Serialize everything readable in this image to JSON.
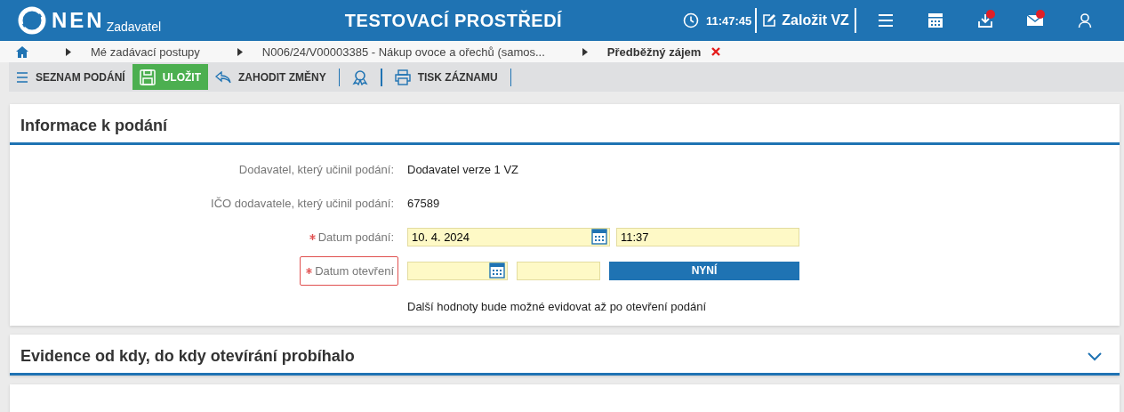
{
  "header": {
    "logo": "NEN",
    "logo_sub": "Zadavatel",
    "title": "TESTOVACÍ PROSTŘEDÍ",
    "clock": "11:47:45",
    "create_button": "Založit VZ",
    "icons": [
      {
        "kind": "menu",
        "badge": false
      },
      {
        "kind": "calendar",
        "badge": false
      },
      {
        "kind": "inbox",
        "badge": true
      },
      {
        "kind": "mail",
        "badge": true
      },
      {
        "kind": "user",
        "badge": false
      }
    ]
  },
  "breadcrumb": [
    {
      "label": "Mé zadávací postupy",
      "current": false
    },
    {
      "label": "N006/24/V00003385 - Nákup ovoce a ořechů (samos...",
      "current": false
    },
    {
      "label": "Předběžný zájem",
      "current": true
    }
  ],
  "toolbar": [
    {
      "kind": "list",
      "label": "SEZNAM PODÁNÍ"
    },
    {
      "kind": "save",
      "label": "ULOŽIT"
    },
    {
      "kind": "discard",
      "label": "ZAHODIT ZMĚNY"
    },
    {
      "kind": "award"
    },
    {
      "kind": "print",
      "label": "TISK ZÁZNAMU"
    }
  ],
  "section": {
    "title": "Informace k podání",
    "rows": [
      {
        "kind": "text",
        "label": "Dodavatel, který učinil podání:",
        "value": "Dodavatel verze 1 VZ"
      },
      {
        "kind": "text",
        "label": "IČO dodavatele, který učinil podání:",
        "value": "67589"
      },
      {
        "kind": "datetime",
        "label": "Datum podání:",
        "required": true,
        "invalid": false,
        "date": "10. 4. 2024",
        "time": "11:37"
      },
      {
        "kind": "datetime",
        "label": "Datum otevření",
        "required": true,
        "invalid": true,
        "button": "NYNÍ"
      }
    ],
    "note": "Další hodnoty bude možné evidovat až po otevření podání"
  },
  "section2": {
    "title": "Evidence od kdy, do kdy otevírání probíhalo",
    "expanded": false
  }
}
